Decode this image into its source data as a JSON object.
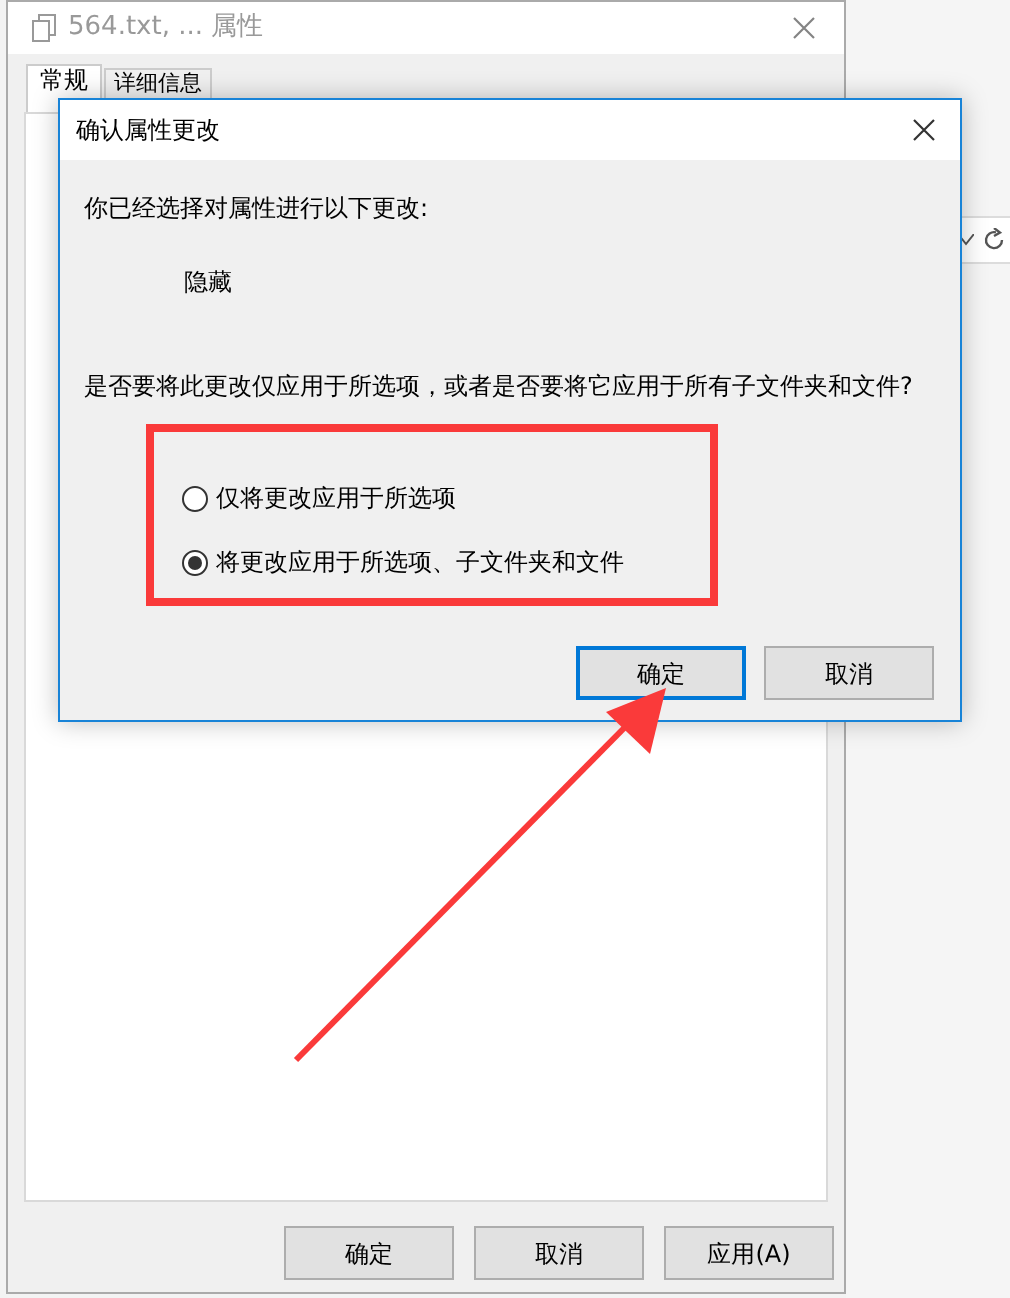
{
  "window": {
    "title": "564.txt, ... 属性"
  },
  "tabs": [
    {
      "label": "常规",
      "selected": true
    },
    {
      "label": "详细信息",
      "selected": false
    }
  ],
  "buttons": [
    "确定",
    "取消",
    "应用(A)"
  ],
  "dialog": {
    "title": "确认属性更改",
    "intro": "你已经选择对属性进行以下更改:",
    "change": "隐藏",
    "question": "是否要将此更改仅应用于所选项，或者是否要将它应用于所有子文件夹和文件?",
    "options": [
      {
        "label": "仅将更改应用于所选项",
        "selected": false
      },
      {
        "label": "将更改应用于所选项、子文件夹和文件",
        "selected": true
      }
    ],
    "buttons": [
      {
        "label": "确定",
        "default": true
      },
      {
        "label": "取消",
        "default": false
      }
    ]
  }
}
